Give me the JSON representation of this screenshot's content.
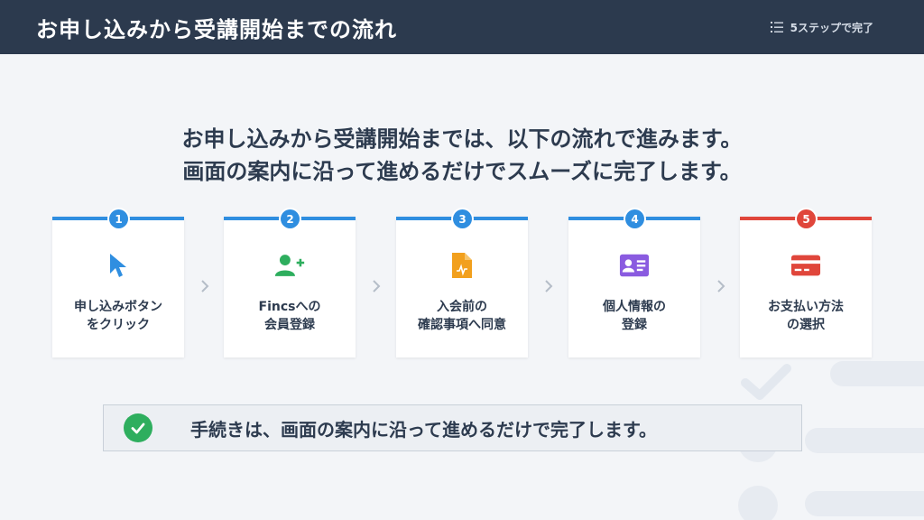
{
  "header": {
    "title": "お申し込みから受講開始までの流れ",
    "steps_badge": "5ステップで完了",
    "steps_badge_icon": "list-icon"
  },
  "intro": {
    "line1": "お申し込みから受講開始までは、以下の流れで進みます。",
    "line2": "画面の案内に沿って進めるだけでスムーズに完了します。"
  },
  "steps": [
    {
      "number": "1",
      "line1": "申し込みボタン",
      "line2": "をクリック",
      "icon": "cursor-icon",
      "color": "#2f8ee0",
      "icon_color": "#2f8ee0"
    },
    {
      "number": "2",
      "line1": "Fincsへの",
      "line2": "会員登録",
      "icon": "add-user-icon",
      "color": "#2f8ee0",
      "icon_color": "#2eae5e"
    },
    {
      "number": "3",
      "line1": "入会前の",
      "line2": "確認事項へ同意",
      "icon": "document-icon",
      "color": "#2f8ee0",
      "icon_color": "#f2a01d"
    },
    {
      "number": "4",
      "line1": "個人情報の",
      "line2": "登録",
      "icon": "id-card-icon",
      "color": "#2f8ee0",
      "icon_color": "#8a5be0"
    },
    {
      "number": "5",
      "line1": "お支払い方法",
      "line2": "の選択",
      "icon": "credit-card-icon",
      "color": "#e0463b",
      "icon_color": "#e0463b"
    }
  ],
  "summary": {
    "text": "手続きは、画面の案内に沿って進めるだけで完了します。",
    "icon": "check-circle-icon",
    "icon_color": "#2eae5e"
  }
}
